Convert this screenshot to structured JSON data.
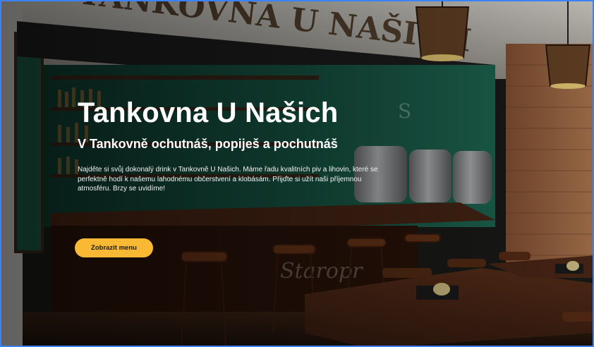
{
  "hero": {
    "sign_text": "TANKOVNA U NAŠICH",
    "title": "Tankovna U Našich",
    "subtitle": "V Tankovně ochutnáš, popiješ a pochutnáš",
    "description": "Najděte si svůj dokonalý drink v Tankovně U Našich. Máme řadu kvalitních piv a lihovin, které se perfektně hodí k našemu lahodnému občerstvení a klobásám. Přijďte si užít naši příjemnou atmosféru. Brzy se uvidíme!",
    "cta_label": "Zobrazit menu"
  },
  "colors": {
    "accent": "#f9b934",
    "wall_green": "#1f6b55",
    "brick": "#a9714a",
    "wood": "#5a2f1a",
    "frame_border": "#3b82f6"
  }
}
